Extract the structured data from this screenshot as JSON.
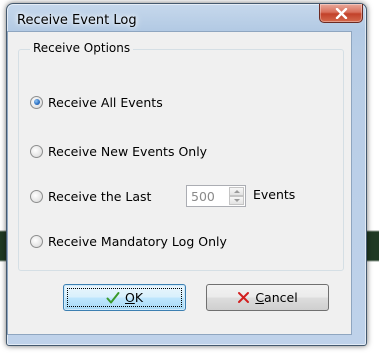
{
  "window": {
    "title": "Receive Event Log"
  },
  "group": {
    "legend": "Receive Options"
  },
  "options": [
    {
      "label": "Receive All Events",
      "checked": true
    },
    {
      "label": "Receive New Events Only",
      "checked": false
    },
    {
      "label": "Receive the Last",
      "checked": false
    },
    {
      "label": "Receive Mandatory Log Only",
      "checked": false
    }
  ],
  "last_count": {
    "value": "500",
    "suffix": "Events"
  },
  "buttons": {
    "ok_label": "OK",
    "cancel_label": "Cancel"
  },
  "icons": {
    "close": "close-icon",
    "ok": "checkmark-icon",
    "cancel": "cross-icon"
  },
  "colors": {
    "ok_check": "#3a9a2a",
    "cancel_cross": "#d21f1f",
    "radio_selected": "#2a6fc2",
    "close_button": "#c2412a"
  }
}
